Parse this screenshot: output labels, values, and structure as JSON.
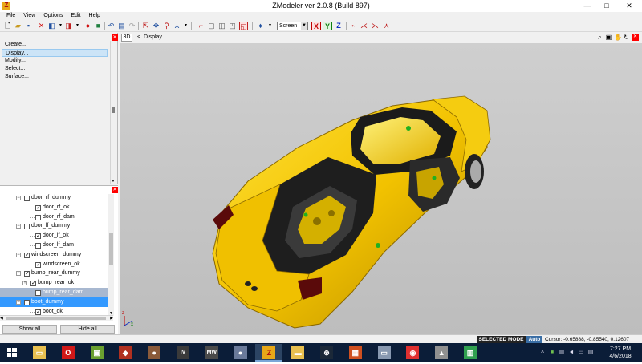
{
  "window": {
    "title": "ZModeler ver 2.0.8 (Build 897)",
    "minimize_glyph": "—",
    "maximize_glyph": "□",
    "close_glyph": "✕"
  },
  "menu": {
    "file": "File",
    "view": "View",
    "options": "Options",
    "edit": "Edit",
    "help": "Help"
  },
  "toolbar": {
    "coord_system": "Screen",
    "axis_x": "X",
    "axis_y": "Y",
    "axis_z": "Z"
  },
  "command_panel": {
    "items": [
      {
        "label": "Create..."
      },
      {
        "label": "Display..."
      },
      {
        "label": "Modify..."
      },
      {
        "label": "Select..."
      },
      {
        "label": "Surface..."
      }
    ],
    "selected_index": 1
  },
  "tree": {
    "rows": [
      {
        "label": "door_rf_dummy",
        "checked": false
      },
      {
        "label": "door_rf_ok",
        "checked": true
      },
      {
        "label": "door_rf_dam",
        "checked": false
      },
      {
        "label": "door_lf_dummy",
        "checked": false
      },
      {
        "label": "door_lf_ok",
        "checked": true
      },
      {
        "label": "door_lf_dam",
        "checked": false
      },
      {
        "label": "windscreen_dummy",
        "checked": true
      },
      {
        "label": "windscreen_ok",
        "checked": true
      },
      {
        "label": "bump_rear_dummy",
        "checked": true
      },
      {
        "label": "bump_rear_ok",
        "checked": true
      },
      {
        "label": "bump_rear_dam",
        "checked": false
      },
      {
        "label": "boot_dummy",
        "checked": false
      },
      {
        "label": "boot_ok",
        "checked": true
      }
    ],
    "show_all": "Show all",
    "hide_all": "Hide all"
  },
  "viewport": {
    "mode": "3D",
    "label": "Display",
    "back_glyph": "<"
  },
  "statusbar": {
    "mode": "SELECTED MODE",
    "auto": "Auto",
    "cursor": "Cursor: -0.65888, -0.85540, 0.12607"
  },
  "taskbar": {
    "apps": [
      {
        "icon": "file-explorer-icon",
        "glyph": "▭",
        "color": "#e8c050"
      },
      {
        "icon": "opera-icon",
        "glyph": "O",
        "color": "#d01818"
      },
      {
        "icon": "archive-icon",
        "glyph": "▣",
        "color": "#6aa030"
      },
      {
        "icon": "game-icon",
        "glyph": "◆",
        "color": "#b03020"
      },
      {
        "icon": "cowboy-game-icon",
        "glyph": "●",
        "color": "#8a5a3a"
      },
      {
        "icon": "gta-iv-icon",
        "glyph": "IV",
        "color": "#3a3a3a"
      },
      {
        "icon": "nfs-mw-icon",
        "glyph": "MW",
        "color": "#4a4a4a"
      },
      {
        "icon": "portrait-game-icon",
        "glyph": "●",
        "color": "#6a7a9a"
      },
      {
        "icon": "zmodeler-icon",
        "glyph": "Z",
        "color": "#e8a818"
      },
      {
        "icon": "folder-icon",
        "glyph": "▬",
        "color": "#e8c050"
      },
      {
        "icon": "steam-icon",
        "glyph": "⊛",
        "color": "#1b2838"
      },
      {
        "icon": "tiles-icon",
        "glyph": "▦",
        "color": "#d05020"
      },
      {
        "icon": "display-settings-icon",
        "glyph": "▭",
        "color": "#8898b0"
      },
      {
        "icon": "headphones-icon",
        "glyph": "◉",
        "color": "#e03030"
      },
      {
        "icon": "car-tool-icon",
        "glyph": "▲",
        "color": "#909090"
      },
      {
        "icon": "paint-icon",
        "glyph": "▥",
        "color": "#30a050"
      }
    ],
    "time": "7:27 PM",
    "date": "4/6/2018"
  },
  "colors": {
    "car_body": "#f2c200",
    "car_dark": "#1a1a1a",
    "viewport_bg": "#c8c8c8",
    "selected_blue": "#3399ff",
    "taskbar_bg": "#0b1d38"
  }
}
